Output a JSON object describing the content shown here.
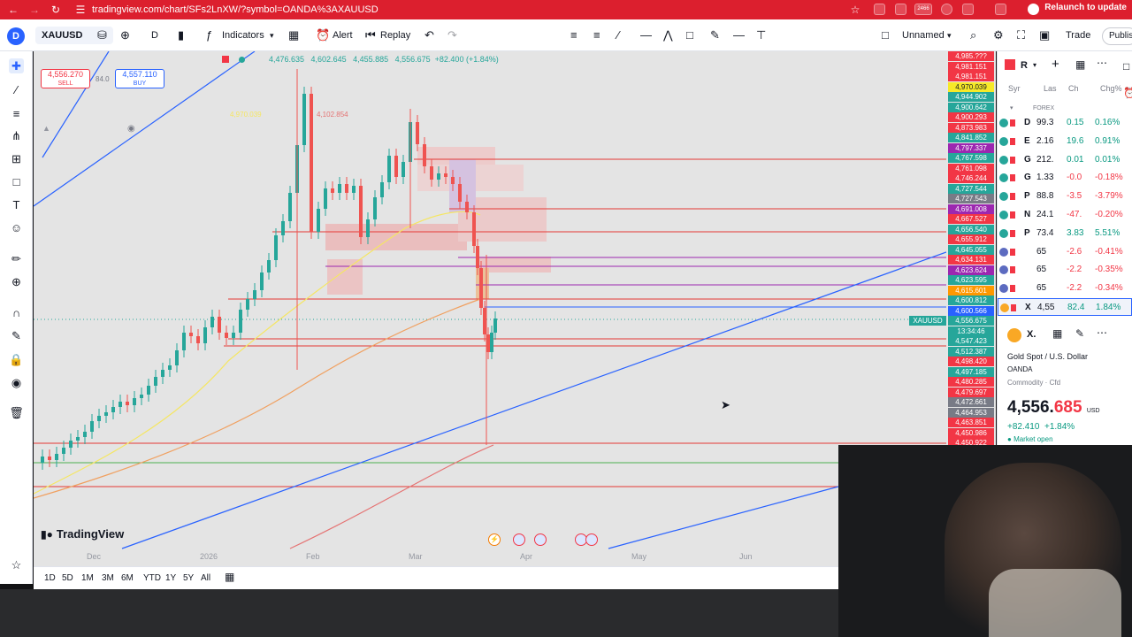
{
  "browser": {
    "url": "tradingview.com/chart/SFs2LnXW/?symbol=OANDA%3AXAUUSD",
    "relaunch_label": "Relaunch to update",
    "ext_badge": "2466"
  },
  "toolbar": {
    "account_initial": "D",
    "symbol": "XAUUSD",
    "interval": "D",
    "indicators_label": "Indicators",
    "alert_label": "Alert",
    "replay_label": "Replay",
    "layout_name": "Unnamed",
    "trade_label": "Trade",
    "publish_label": "Publis"
  },
  "chart": {
    "ohlc_text": "4,476.635   4,602.645   4,455.885   4,556.675  +82.400 (+1.84%)",
    "sell_price": "4,556.270",
    "sell_label": "SELL",
    "spread": "84.0",
    "buy_price": "4,557.110",
    "buy_label": "BUY",
    "ma_label_1": "4,970.039",
    "ma_label_2": "4,102.854",
    "watermark": "TradingView",
    "x_labels": [
      "Dec",
      "2026",
      "Feb",
      "Mar",
      "Apr",
      "May",
      "Jun"
    ],
    "symbol_tag": "XAUUSD",
    "countdown": "13:34:46",
    "colors": {
      "bull": "#26a69a",
      "bear": "#ef5350",
      "trendline": "#2962ff",
      "level": "#e53935",
      "ma_yellow": "#f5e663",
      "ma_orange": "#f0a060"
    }
  },
  "price_scale": [
    {
      "v": "4,985.???",
      "bg": "#f23645"
    },
    {
      "v": "4,981.151",
      "bg": "#f23645"
    },
    {
      "v": "4,981.151",
      "bg": "#f23645"
    },
    {
      "v": "4,970.039",
      "bg": "#f7e928"
    },
    {
      "v": "4,944.902",
      "bg": "#26a69a"
    },
    {
      "v": "4,900.642",
      "bg": "#26a69a"
    },
    {
      "v": "4,900.293",
      "bg": "#f23645"
    },
    {
      "v": "4,873.983",
      "bg": "#f23645"
    },
    {
      "v": "4,841.852",
      "bg": "#26a69a"
    },
    {
      "v": "4,797.337",
      "bg": "#9c27b0"
    },
    {
      "v": "4,767.598",
      "bg": "#26a69a"
    },
    {
      "v": "4,761.098",
      "bg": "#f23645"
    },
    {
      "v": "4,746.244",
      "bg": "#f23645"
    },
    {
      "v": "4,727.544",
      "bg": "#26a69a"
    },
    {
      "v": "4,727.543",
      "bg": "#787b86"
    },
    {
      "v": "4,691.008",
      "bg": "#9c27b0"
    },
    {
      "v": "4,667.527",
      "bg": "#f23645"
    },
    {
      "v": "4,656.540",
      "bg": "#26a69a"
    },
    {
      "v": "4,655.912",
      "bg": "#f23645"
    },
    {
      "v": "4,645.055",
      "bg": "#26a69a"
    },
    {
      "v": "4,634.131",
      "bg": "#f23645"
    },
    {
      "v": "4,623.624",
      "bg": "#9c27b0"
    },
    {
      "v": "4,623.595",
      "bg": "#26a69a"
    },
    {
      "v": "4,615.601",
      "bg": "#ff9800"
    },
    {
      "v": "4,600.812",
      "bg": "#26a69a"
    },
    {
      "v": "4,600.566",
      "bg": "#2962ff"
    },
    {
      "v": "4,556.675",
      "bg": "#26a69a"
    },
    {
      "v": "13:34:46",
      "bg": "#26a69a"
    },
    {
      "v": "4,547.423",
      "bg": "#26a69a"
    },
    {
      "v": "4,512.387",
      "bg": "#26a69a"
    },
    {
      "v": "4,498.420",
      "bg": "#f23645"
    },
    {
      "v": "4,497.185",
      "bg": "#26a69a"
    },
    {
      "v": "4,480.285",
      "bg": "#f23645"
    },
    {
      "v": "4,479.697",
      "bg": "#f23645"
    },
    {
      "v": "4,472.661",
      "bg": "#787b86"
    },
    {
      "v": "4,464.953",
      "bg": "#787b86"
    },
    {
      "v": "4,463.851",
      "bg": "#f23645"
    },
    {
      "v": "4,450.986",
      "bg": "#f23645"
    },
    {
      "v": "4,450.922",
      "bg": "#f23645"
    }
  ],
  "bottom": {
    "ranges": [
      "1D",
      "5D",
      "1M",
      "3M",
      "6M",
      "YTD",
      "1Y",
      "5Y",
      "All"
    ]
  },
  "watchlist": {
    "title": "R",
    "cols": [
      "Syr",
      "Las",
      "Ch",
      "Chg%"
    ],
    "section": "FOREX",
    "rows": [
      {
        "sym": "D",
        "last": "99.3",
        "chg": "0.15",
        "pct": "0.16%",
        "color": "#089981"
      },
      {
        "sym": "E",
        "last": "2.16",
        "chg": "19.6",
        "pct": "0.91%",
        "color": "#089981"
      },
      {
        "sym": "G",
        "last": "212.",
        "chg": "0.01",
        "pct": "0.01%",
        "color": "#089981"
      },
      {
        "sym": "G",
        "last": "1.33",
        "chg": "-0.0",
        "pct": "-0.18%",
        "color": "#f23645"
      },
      {
        "sym": "P",
        "last": "88.8",
        "chg": "-3.5",
        "pct": "-3.79%",
        "color": "#f23645"
      },
      {
        "sym": "N",
        "last": "24.1",
        "chg": "-47.",
        "pct": "-0.20%",
        "color": "#f23645"
      },
      {
        "sym": "P",
        "last": "73.4",
        "chg": "3.83",
        "pct": "5.51%",
        "color": "#089981"
      },
      {
        "sym": "",
        "last": "65",
        "chg": "-2.6",
        "pct": "-0.41%",
        "color": "#f23645"
      },
      {
        "sym": "",
        "last": "65",
        "chg": "-2.2",
        "pct": "-0.35%",
        "color": "#f23645"
      },
      {
        "sym": "",
        "last": "65",
        "chg": "-2.2",
        "pct": "-0.34%",
        "color": "#f23645"
      },
      {
        "sym": "X",
        "last": "4,55",
        "chg": "82.4",
        "pct": "1.84%",
        "color": "#089981"
      }
    ]
  },
  "details": {
    "sym": "X.",
    "name": "Gold Spot / U.S. Dollar",
    "exchange": "OANDA",
    "category": "Commodity · Cfd",
    "price_main": "4,556.",
    "price_tail": "685",
    "currency": "USD",
    "change": "+82.410  +1.84%",
    "market_status": "Market open"
  }
}
